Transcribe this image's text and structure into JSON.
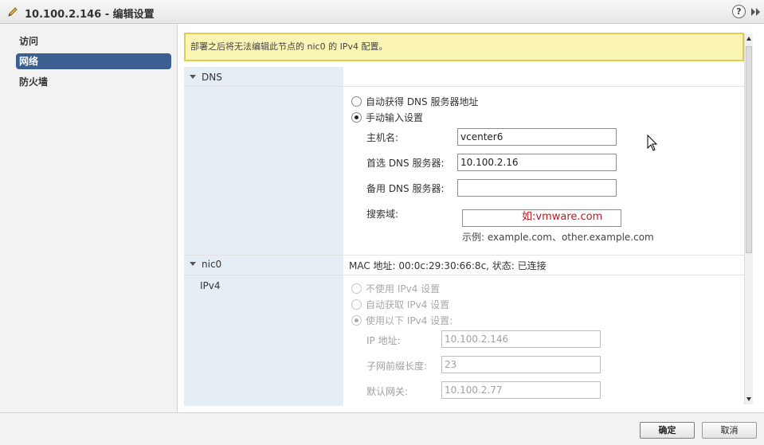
{
  "window": {
    "title": "10.100.2.146 - 编辑设置",
    "help_label": "?"
  },
  "sidebar": {
    "items": [
      {
        "label": "访问"
      },
      {
        "label": "网络",
        "selected": true
      },
      {
        "label": "防火墙"
      }
    ]
  },
  "warning": "部署之后将无法编辑此节点的 nic0 的 IPv4 配置。",
  "dns": {
    "section_label": "DNS",
    "option_auto": "自动获得 DNS 服务器地址",
    "option_manual": "手动输入设置",
    "selected": "manual",
    "hostname_label": "主机名:",
    "hostname_value": "vcenter6",
    "preferred_label": "首选 DNS 服务器:",
    "preferred_value": "10.100.2.16",
    "alternate_label": "备用 DNS 服务器:",
    "alternate_value": "",
    "search_label": "搜索域:",
    "search_annotation": "如:vmware.com",
    "search_hint": "示例: example.com、other.example.com"
  },
  "nic": {
    "section_label": "nic0",
    "mac_status": "MAC 地址: 00:0c:29:30:66:8c, 状态: 已连接",
    "ipv4_label": "IPv4",
    "option_none": "不使用 IPv4 设置",
    "option_auto": "自动获取 IPv4 设置",
    "option_static": "使用以下 IPv4 设置:",
    "selected": "static",
    "ip_label": "IP 地址:",
    "ip_value": "10.100.2.146",
    "prefix_label": "子网前缀长度:",
    "prefix_value": "23",
    "gateway_label": "默认网关:",
    "gateway_value": "10.100.2.77"
  },
  "footer": {
    "ok_label": "确定",
    "cancel_label": "取消"
  },
  "colors": {
    "nav_selected": "#3b5f91",
    "warning_bg": "#fbf5b5",
    "warning_border": "#e2cd54",
    "label_column": "#e5eef5",
    "annotation": "#c0181f"
  }
}
